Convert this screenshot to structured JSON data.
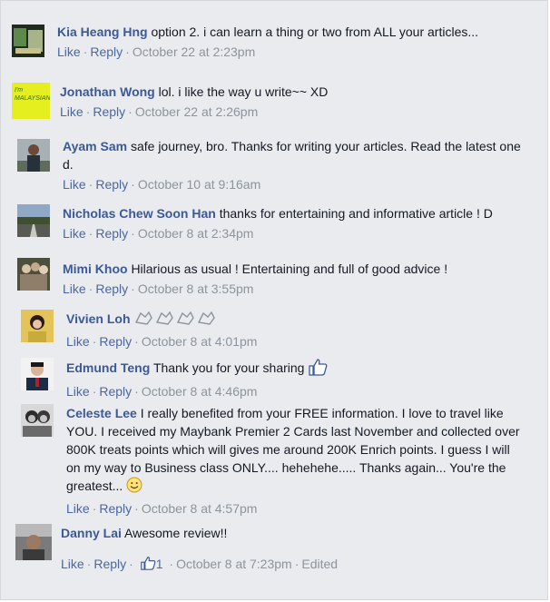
{
  "labels": {
    "like": "Like",
    "reply": "Reply",
    "edited": "Edited"
  },
  "comments": [
    {
      "author": "Kia Heang Hng",
      "text": "option 2. i can learn a thing or two from ALL your articles...",
      "time": "October 22 at 2:23pm"
    },
    {
      "author": "Jonathan Wong",
      "text": "lol. i like the way u write~~ XD",
      "time": "October 22 at 2:26pm",
      "avatar_text": "I'm MALAYSIAN"
    },
    {
      "author": "Ayam Sam",
      "text": "safe journey, bro. Thanks for writing your articles. Read the latest one",
      "text2": "d.",
      "time": "October 10 at 9:16am"
    },
    {
      "author": "Nicholas Chew Soon Han",
      "text": "thanks for entertaining and informative article ! D",
      "time": "October 8 at 2:34pm"
    },
    {
      "author": "Mimi Khoo",
      "text": "Hilarious as usual ! Entertaining and full of good advice !",
      "time": "October 8 at 3:55pm"
    },
    {
      "author": "Vivien Loh",
      "text": "",
      "time": "October 8 at 4:01pm",
      "emoticon": "clapping-hands-icon"
    },
    {
      "author": "Edmund Teng",
      "text": "Thank you for your sharing",
      "time": "October 8 at 4:46pm",
      "emoticon": "thumbs-up-icon"
    },
    {
      "author": "Celeste Lee",
      "text": "I really benefited from your FREE information. I love to travel like",
      "lines": [
        "YOU. I received my Maybank Premier 2 Cards last November and collected over",
        "800K treats points which will gives me around 200K Enrich points. I guess I will",
        "on my way to Business class ONLY.... hehehehe..... Thanks again... You're the",
        "greatest..."
      ],
      "time": "October 8 at 4:57pm",
      "emoticon": "smile-icon"
    },
    {
      "author": "Danny Lai",
      "text": "Awesome review!!",
      "time": "October 8 at 7:23pm",
      "likes": "1"
    }
  ],
  "colors": {
    "author": "#3b5998",
    "link": "#4b67a1",
    "muted": "#8d949e",
    "background": "#e9ebee"
  }
}
